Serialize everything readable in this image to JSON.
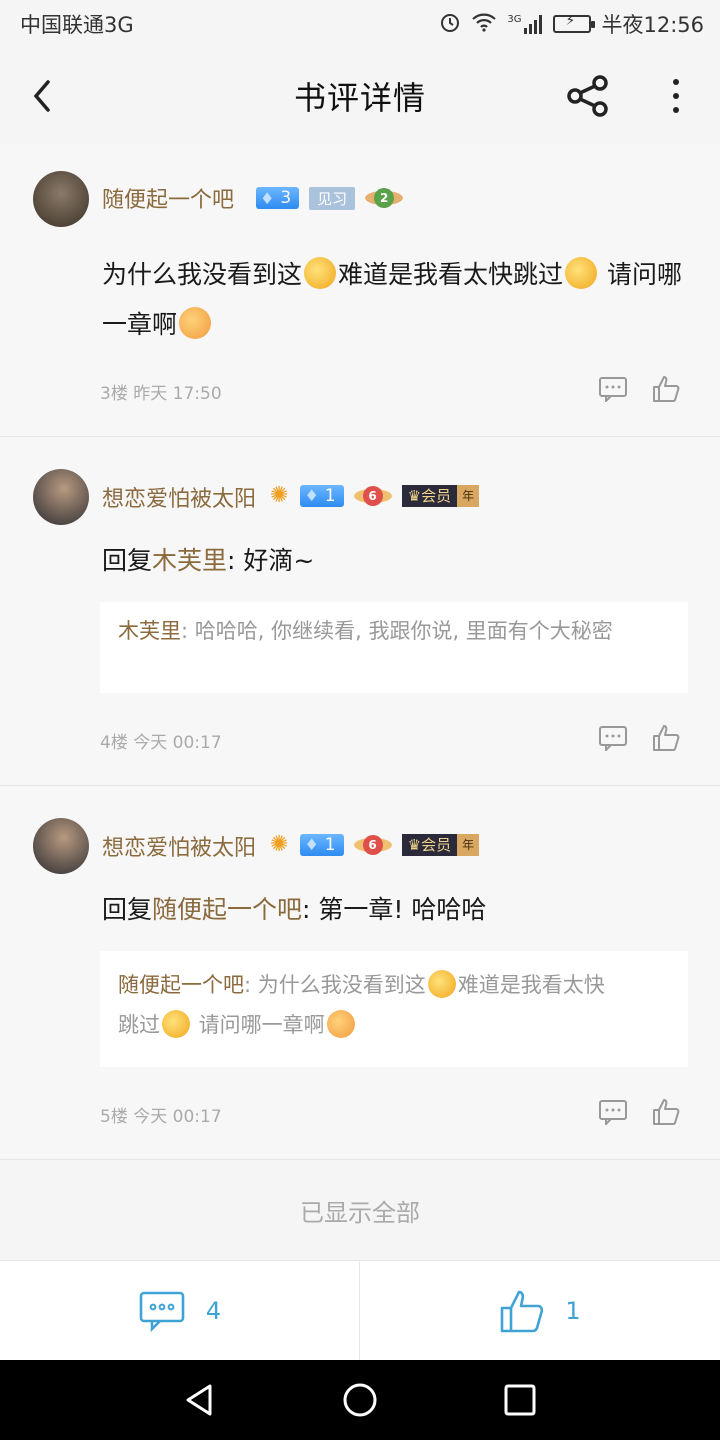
{
  "status_bar": {
    "carrier": "中国联通3G",
    "network": "3G",
    "time": "半夜12:56"
  },
  "header": {
    "title": "书评详情"
  },
  "posts": [
    {
      "username": "随便起一个吧",
      "level": "3",
      "tag": "见习",
      "medal_level": "2",
      "text_1": "为什么我没看到这",
      "text_2": "难道是我看太快跳过",
      "text_3": " 请问哪一章啊",
      "floor": "3楼",
      "time": "昨天 17:50"
    },
    {
      "username": "想恋爱怕被太阳",
      "level": "1",
      "medal_level": "6",
      "member_label": "会员",
      "member_period": "年",
      "reply_prefix": "回复",
      "reply_to": "木芙里",
      "reply_text": ": 好滴~",
      "quote_name": "木芙里",
      "quote_text": ": 哈哈哈, 你继续看, 我跟你说, 里面有个大秘密",
      "floor": "4楼",
      "time": "今天 00:17"
    },
    {
      "username": "想恋爱怕被太阳",
      "level": "1",
      "medal_level": "6",
      "member_label": "会员",
      "member_period": "年",
      "reply_prefix": "回复",
      "reply_to": "随便起一个吧",
      "reply_text": ": 第一章! 哈哈哈",
      "quote_name": "随便起一个吧",
      "quote_text_1": ": 为什么我没看到这",
      "quote_text_2": "难道是我看太快",
      "quote_text_3": "跳过",
      "quote_text_4": " 请问哪一章啊",
      "floor": "5楼",
      "time": "今天 00:17"
    }
  ],
  "footer_note": "已显示全部",
  "bottom_bar": {
    "comment_count": "4",
    "like_count": "1"
  },
  "colors": {
    "accent": "#3fa3d6",
    "username": "#8b6a3e",
    "meta": "#aaaaaa"
  }
}
